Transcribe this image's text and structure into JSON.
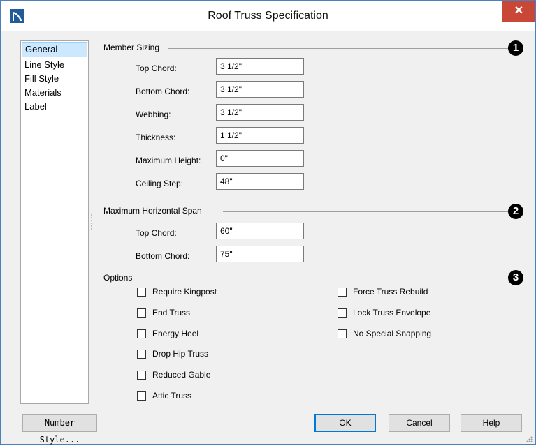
{
  "window": {
    "title": "Roof Truss Specification",
    "close_glyph": "✕"
  },
  "sidebar": {
    "items": [
      {
        "label": "General",
        "selected": true
      },
      {
        "label": "Line Style",
        "selected": false
      },
      {
        "label": "Fill Style",
        "selected": false
      },
      {
        "label": "Materials",
        "selected": false
      },
      {
        "label": "Label",
        "selected": false
      }
    ]
  },
  "member_sizing": {
    "group_label": "Member Sizing",
    "callout": "1",
    "fields": {
      "top_chord": {
        "label": "Top Chord:",
        "value": "3 1/2\""
      },
      "bottom_chord": {
        "label": "Bottom Chord:",
        "value": "3 1/2\""
      },
      "webbing": {
        "label": "Webbing:",
        "value": "3 1/2\""
      },
      "thickness": {
        "label": "Thickness:",
        "value": "1 1/2\""
      },
      "max_height": {
        "label": "Maximum Height:",
        "value": "0\""
      },
      "ceiling_step": {
        "label": "Ceiling Step:",
        "value": "48\""
      }
    }
  },
  "max_span": {
    "group_label": "Maximum Horizontal Span",
    "callout": "2",
    "fields": {
      "top_chord": {
        "label": "Top Chord:",
        "value": "60\""
      },
      "bottom_chord": {
        "label": "Bottom Chord:",
        "value": "75\""
      }
    }
  },
  "options": {
    "group_label": "Options",
    "callout": "3",
    "left": [
      {
        "label": "Require Kingpost",
        "checked": false
      },
      {
        "label": "End Truss",
        "checked": false
      },
      {
        "label": "Energy Heel",
        "checked": false
      },
      {
        "label": "Drop Hip Truss",
        "checked": false
      },
      {
        "label": "Reduced Gable",
        "checked": false
      },
      {
        "label": "Attic Truss",
        "checked": false
      }
    ],
    "right": [
      {
        "label": "Force Truss Rebuild",
        "checked": false
      },
      {
        "label": "Lock Truss Envelope",
        "checked": false
      },
      {
        "label": "No Special Snapping",
        "checked": false
      }
    ]
  },
  "buttons": {
    "number_style": "Number Style...",
    "ok": "OK",
    "cancel": "Cancel",
    "help": "Help"
  },
  "colors": {
    "title_accent": "#1f5c99",
    "close_bg": "#c84737",
    "selected_bg": "#cce8ff"
  }
}
